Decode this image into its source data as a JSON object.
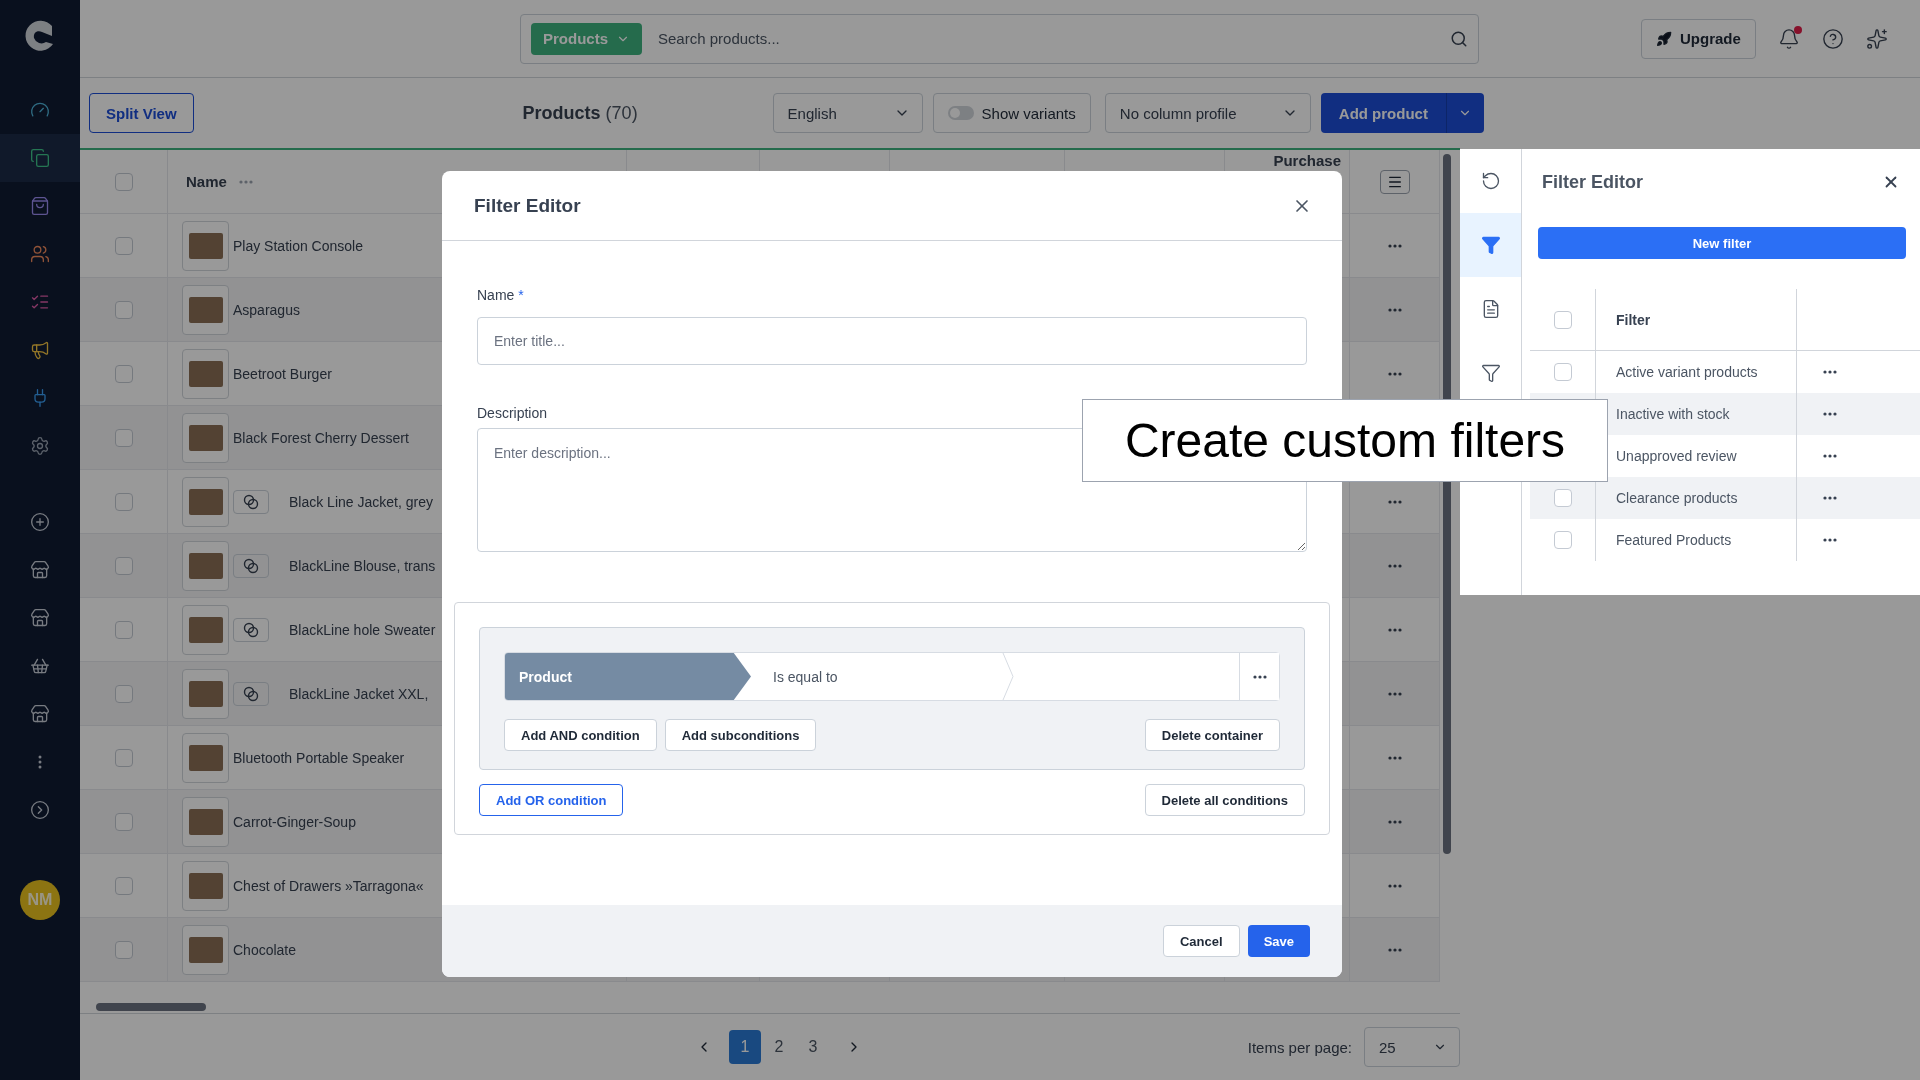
{
  "sidebar": {
    "items": [
      {
        "kind": "gauge",
        "selected": false
      },
      {
        "kind": "copy",
        "selected": true
      },
      {
        "kind": "bag",
        "selected": false
      },
      {
        "kind": "users",
        "selected": false
      },
      {
        "kind": "list",
        "selected": false
      },
      {
        "kind": "megaphone",
        "selected": false
      },
      {
        "kind": "plug",
        "selected": false
      },
      {
        "kind": "gear",
        "selected": false
      },
      {
        "kind": "plus",
        "selected": false
      },
      {
        "kind": "store",
        "selected": false
      },
      {
        "kind": "store",
        "selected": false
      },
      {
        "kind": "basket",
        "selected": false
      },
      {
        "kind": "store",
        "selected": false
      },
      {
        "kind": "more",
        "selected": false
      },
      {
        "kind": "expand",
        "selected": false
      }
    ],
    "avatar": "NM"
  },
  "top_bar": {
    "search_scope": "Products",
    "search_placeholder": "Search products...",
    "upgrade_button": "Upgrade",
    "unread_notifications": true
  },
  "toolbar": {
    "split_view_button": "Split View",
    "title": "Products",
    "count": "(70)",
    "language": "English",
    "show_variants": {
      "label": "Show variants",
      "on": false
    },
    "column_profile": "No column profile",
    "add_product_button": "Add product"
  },
  "table": {
    "select_all_checked": false,
    "name_column": "Name",
    "purchase_column": "Purchase",
    "rows": [
      {
        "name": "Play Station Console",
        "variants": false,
        "checked": false
      },
      {
        "name": "Asparagus",
        "variants": false,
        "checked": false
      },
      {
        "name": "Beetroot Burger",
        "variants": false,
        "checked": false
      },
      {
        "name": "Black Forest Cherry Dessert",
        "variants": false,
        "checked": false
      },
      {
        "name": "Black Line Jacket, grey",
        "variants": true,
        "checked": false
      },
      {
        "name": "BlackLine Blouse, trans",
        "variants": true,
        "checked": false
      },
      {
        "name": "BlackLine hole Sweater",
        "variants": true,
        "checked": false
      },
      {
        "name": "BlackLine Jacket XXL,",
        "variants": true,
        "checked": false
      },
      {
        "name": "Bluetooth Portable Speaker",
        "variants": false,
        "checked": false
      },
      {
        "name": "Carrot-Ginger-Soup",
        "variants": false,
        "checked": false
      },
      {
        "name": "Chest of Drawers »Tarragona«",
        "variants": false,
        "checked": false
      },
      {
        "name": "Chocolate",
        "variants": false,
        "checked": false
      }
    ]
  },
  "pagination": {
    "pages": [
      {
        "label": "1",
        "selected": true
      },
      {
        "label": "2",
        "selected": false
      },
      {
        "label": "3",
        "selected": false
      }
    ],
    "items_per_page_label": "Items per page:",
    "items_per_page": "25"
  },
  "filter_modal": {
    "title": "Filter Editor",
    "name_label": "Name",
    "name_required_mark": "*",
    "name_placeholder": "Enter title...",
    "description_label": "Description",
    "description_placeholder": "Enter description...",
    "condition": {
      "field": "Product",
      "operator": "Is equal to"
    },
    "add_and_button": "Add AND condition",
    "add_sub_button": "Add subconditions",
    "delete_container_button": "Delete container",
    "add_or_button": "Add OR condition",
    "delete_all_button": "Delete all conditions",
    "cancel_button": "Cancel",
    "save_button": "Save"
  },
  "filter_panel": {
    "rail": [
      {
        "kind": "undo",
        "selected": false
      },
      {
        "kind": "funnel",
        "selected": true
      },
      {
        "kind": "document",
        "selected": false
      },
      {
        "kind": "funnel",
        "selected": false
      }
    ],
    "title": "Filter Editor",
    "new_filter_button": "New filter",
    "select_all_checked": false,
    "column": "Filter",
    "filters": [
      {
        "name": "Active variant products",
        "checked": false
      },
      {
        "name": "Inactive with stock"
      },
      {
        "name": "Unapproved review"
      },
      {
        "name": "Clearance products",
        "checked": false
      },
      {
        "name": "Featured Products",
        "checked": false
      }
    ]
  },
  "callout": "Create custom filters"
}
